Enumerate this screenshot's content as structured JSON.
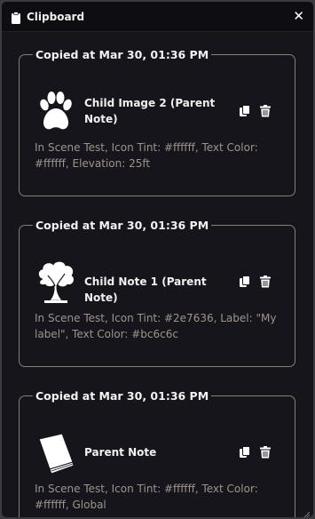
{
  "window": {
    "title": "Clipboard",
    "close_label": "✕"
  },
  "entries": [
    {
      "header": "Copied at Mar 30, 01:36 PM",
      "name": "Child Image 2 (Parent Note)",
      "description": "In Scene Test, Icon Tint: #ffffff, Text Color: #ffffff, Elevation: 25ft",
      "icon": "paw-print-icon"
    },
    {
      "header": "Copied at Mar 30, 01:36 PM",
      "name": "Child Note 1 (Parent Note)",
      "description": "In Scene Test, Icon Tint: #2e7636, Label: \"My label\", Text Color: #bc6c6c",
      "icon": "tree-icon"
    },
    {
      "header": "Copied at Mar 30, 01:36 PM",
      "name": "Parent Note",
      "description": "In Scene Test, Icon Tint: #ffffff, Text Color: #ffffff, Global",
      "icon": "book-icon"
    }
  ],
  "colors": {
    "border": "#8a7d73",
    "description": "#9e948c",
    "background": "#16151b"
  }
}
